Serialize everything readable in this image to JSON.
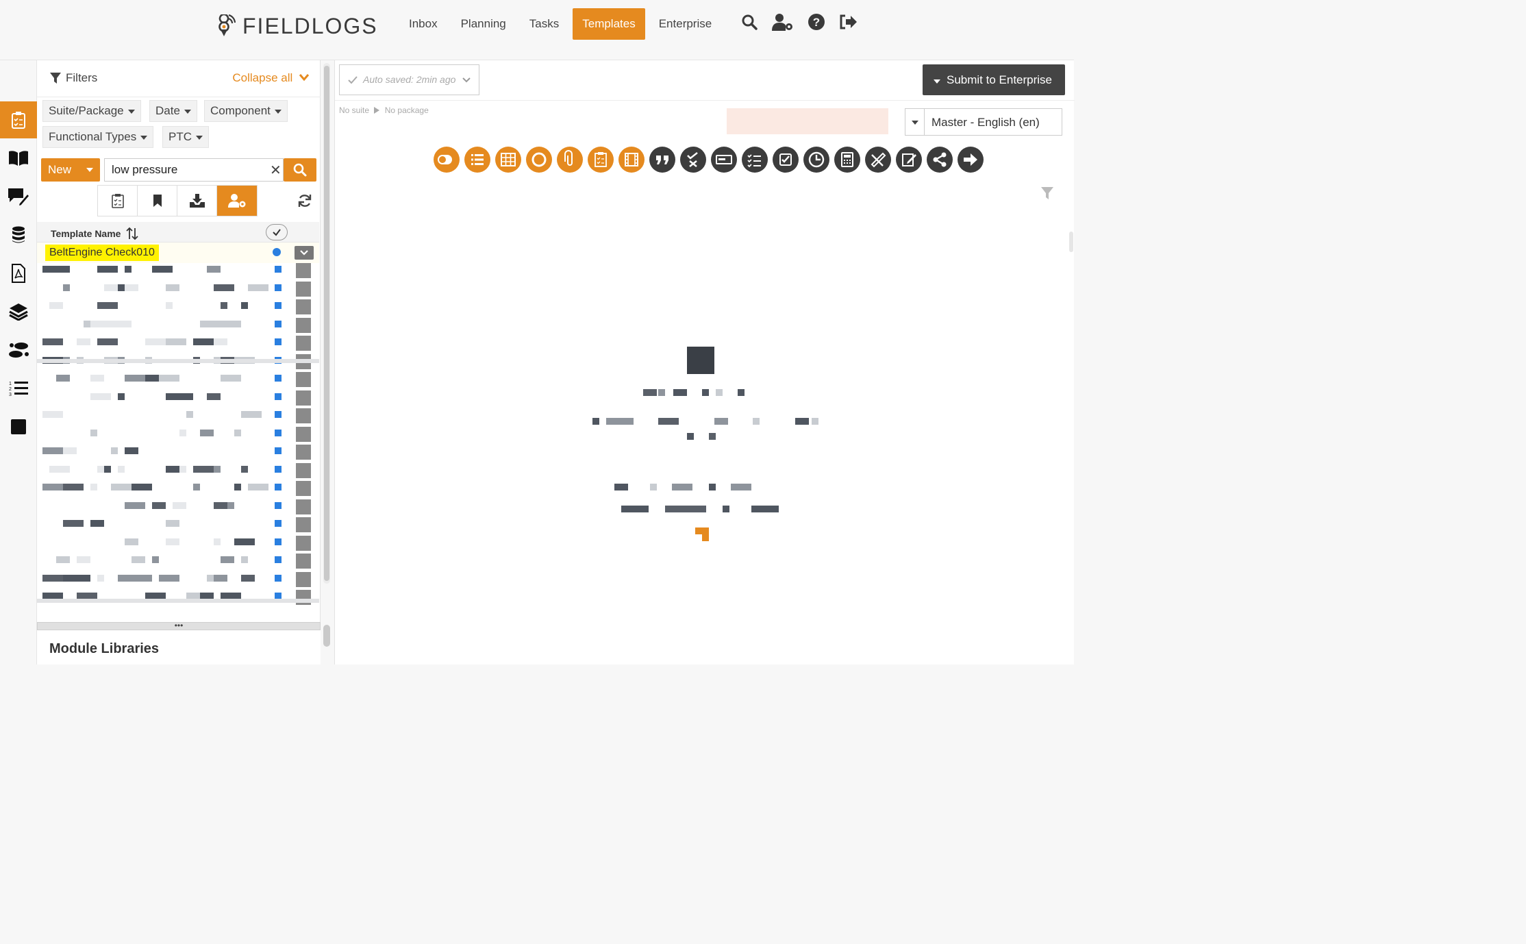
{
  "app": {
    "logo_text": "FIELDLOGS",
    "accent": "#e58a1f",
    "dark": "#3c3c3c"
  },
  "nav": {
    "items": [
      {
        "label": "Inbox",
        "active": false
      },
      {
        "label": "Planning",
        "active": false
      },
      {
        "label": "Tasks",
        "active": false
      },
      {
        "label": "Templates",
        "active": true
      },
      {
        "label": "Enterprise",
        "active": false
      }
    ],
    "icons": [
      "search-icon",
      "user-settings-icon",
      "help-icon",
      "logout-icon"
    ]
  },
  "rail": {
    "items": [
      "clipboard-checklist-icon",
      "book-icon",
      "comment-edit-icon",
      "database-icon",
      "pdf-file-icon",
      "layers-icon",
      "footsteps-icon",
      "numbered-list-icon",
      "square-icon"
    ]
  },
  "filters": {
    "title": "Filters",
    "collapse_all": "Collapse all",
    "chips": [
      "Suite/Package",
      "Date",
      "Component",
      "Functional Types",
      "PTC"
    ]
  },
  "search": {
    "new_label": "New",
    "value": "low pressure",
    "clear_label": "✕"
  },
  "view_tabs": [
    "clipboard-icon",
    "bookmark-icon",
    "inbox-download-icon",
    "user-cog-icon"
  ],
  "table": {
    "header_name": "Template Name",
    "selected_row": "BeltEngine Check010"
  },
  "module_libraries": "Module Libraries",
  "main": {
    "autosave": "Auto saved: 2min ago",
    "submit_label": "Submit to Enterprise",
    "crumb_suite": "No suite",
    "crumb_package": "No package",
    "language": "Master - English (en)",
    "tools": [
      {
        "icon": "toggle-icon",
        "color": "orange"
      },
      {
        "icon": "list-icon",
        "color": "orange"
      },
      {
        "icon": "table-icon",
        "color": "orange"
      },
      {
        "icon": "circle-icon",
        "color": "orange"
      },
      {
        "icon": "attachment-icon",
        "color": "orange"
      },
      {
        "icon": "clipboard-icon",
        "color": "orange"
      },
      {
        "icon": "film-icon",
        "color": "orange"
      },
      {
        "icon": "quote-icon",
        "color": "dark"
      },
      {
        "icon": "check-cross-icon",
        "color": "dark"
      },
      {
        "icon": "input-box-icon",
        "color": "dark"
      },
      {
        "icon": "checklist-icon",
        "color": "dark"
      },
      {
        "icon": "checkbox-icon",
        "color": "dark"
      },
      {
        "icon": "clock-icon",
        "color": "dark"
      },
      {
        "icon": "calculator-icon",
        "color": "dark"
      },
      {
        "icon": "ruler-pencil-icon",
        "color": "dark"
      },
      {
        "icon": "edit-note-icon",
        "color": "dark"
      },
      {
        "icon": "share-icon",
        "color": "dark"
      },
      {
        "icon": "arrow-right-icon",
        "color": "dark"
      }
    ]
  }
}
